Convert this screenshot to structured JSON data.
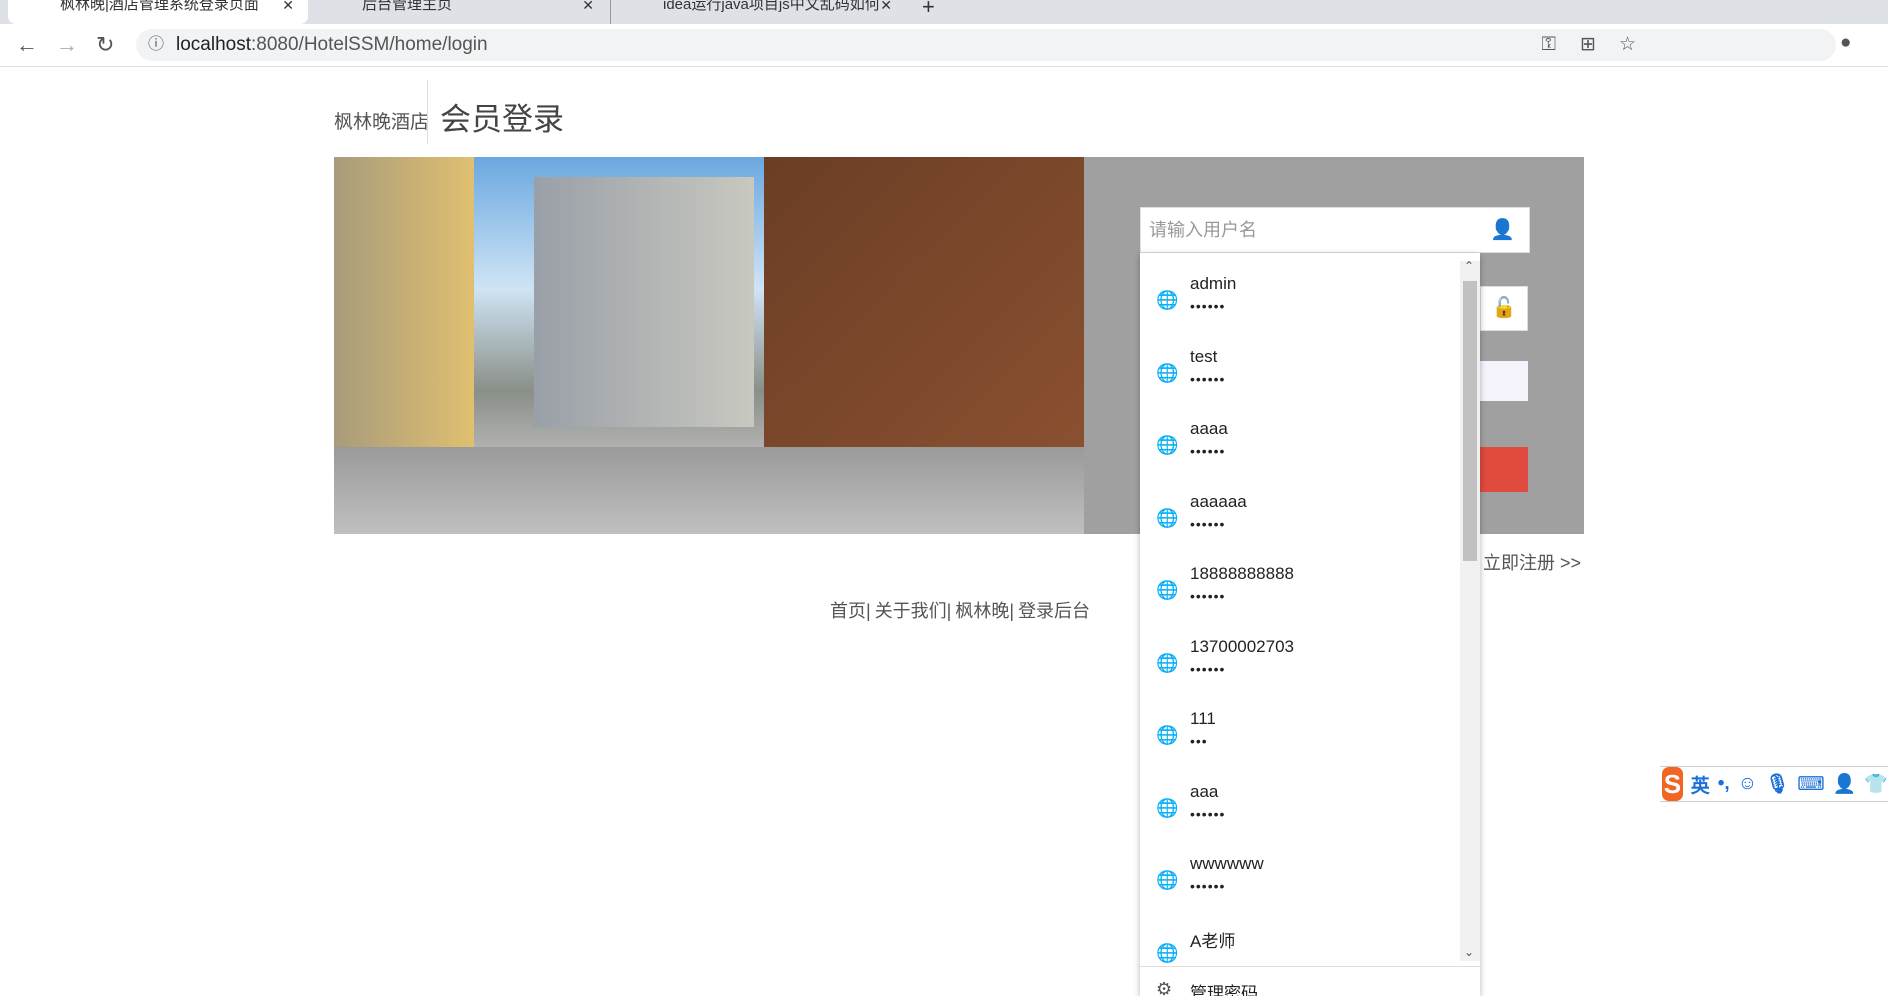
{
  "browser": {
    "tabs": [
      {
        "title": "枫林晚|酒店管理系统登录页面",
        "active": true
      },
      {
        "title": "后台管理主页",
        "active": false
      },
      {
        "title": "idea运行java项目js中文乱码如何",
        "active": false
      }
    ],
    "new_tab": "+",
    "url_host": "localhost",
    "url_rest": ":8080/HotelSSM/home/login"
  },
  "header": {
    "brand": "枫林晚酒店",
    "title": "会员登录"
  },
  "login": {
    "username_placeholder": "请输入用户名",
    "register": "立即注册 >>"
  },
  "autocomplete": {
    "items": [
      {
        "user": "admin",
        "pass": "••••••"
      },
      {
        "user": "test",
        "pass": "••••••"
      },
      {
        "user": "aaaa",
        "pass": "••••••"
      },
      {
        "user": "aaaaaa",
        "pass": "••••••"
      },
      {
        "user": "18888888888",
        "pass": "••••••"
      },
      {
        "user": "13700002703",
        "pass": "••••••"
      },
      {
        "user": "111",
        "pass": "•••"
      },
      {
        "user": "aaa",
        "pass": "••••••"
      },
      {
        "user": "wwwwww",
        "pass": "••••••"
      },
      {
        "user": "A老师",
        "pass": ""
      }
    ],
    "manage": "管理密码"
  },
  "footer": {
    "links": [
      "首页|",
      "关于我们|",
      "枫林晚|",
      "登录后台"
    ]
  },
  "ime": {
    "lang": "英",
    "punct": "•,"
  },
  "colors": {
    "login_button": "#e04a3f",
    "panel": "#a0a0a0"
  }
}
